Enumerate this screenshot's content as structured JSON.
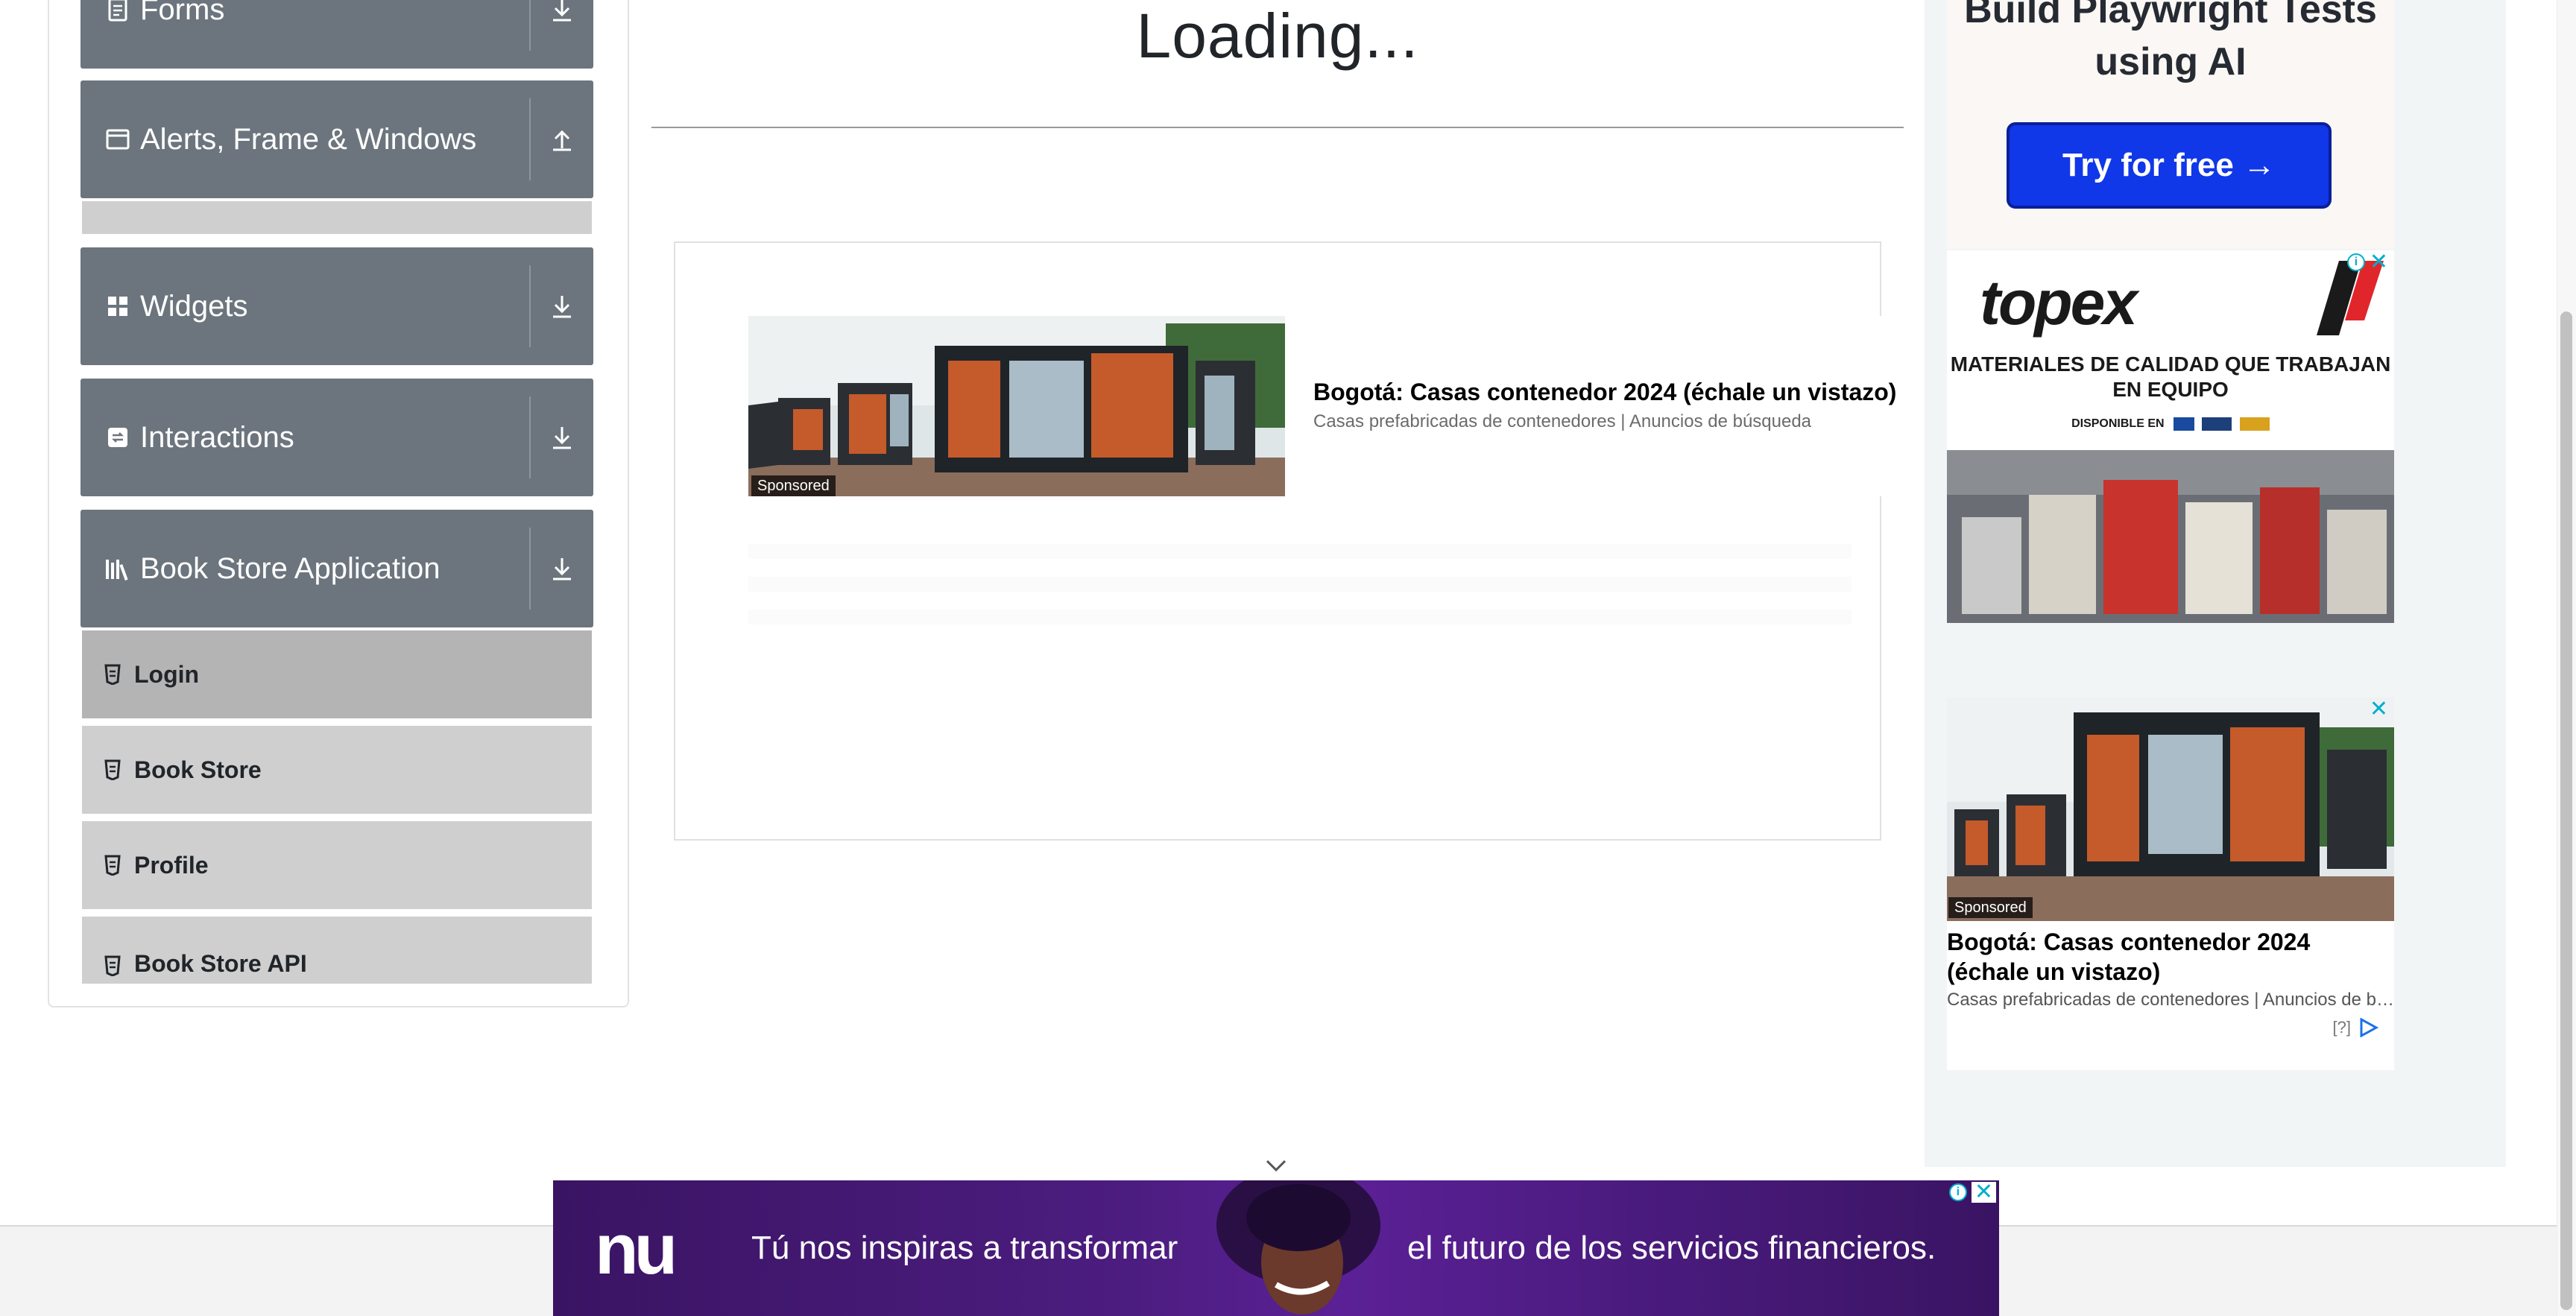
{
  "sidebar": {
    "groups": [
      {
        "title": "Forms",
        "icon": "document-icon",
        "toggle": "download-arrow-icon"
      },
      {
        "title": "Alerts, Frame & Windows",
        "icon": "window-icon",
        "toggle": "upload-arrow-icon"
      },
      {
        "title": "Widgets",
        "icon": "widgets-icon",
        "toggle": "download-arrow-icon"
      },
      {
        "title": "Interactions",
        "icon": "interactions-icon",
        "toggle": "download-arrow-icon"
      },
      {
        "title": "Book Store Application",
        "icon": "books-icon",
        "toggle": "download-arrow-icon"
      }
    ],
    "items": [
      {
        "label": "Login",
        "active": true
      },
      {
        "label": "Book Store",
        "active": false
      },
      {
        "label": "Profile",
        "active": false
      },
      {
        "label": "Book Store API",
        "active": false
      }
    ]
  },
  "main": {
    "title": "Loading...",
    "ad": {
      "sponsored": "Sponsored",
      "headline": "Bogotá: Casas contenedor 2024 (échale un vistazo)",
      "sub": "Casas prefabricadas de contenedores | Anuncios de búsqueda"
    }
  },
  "right_ads": {
    "playwright": {
      "title": "Build Playwright Tests using AI",
      "button": "Try for free →"
    },
    "topex": {
      "logo": "topex",
      "tagline": "MATERIALES DE CALIDAD QUE TRABAJAN EN EQUIPO",
      "available": "DISPONIBLE EN"
    },
    "house": {
      "sponsored": "Sponsored",
      "headline": "Bogotá: Casas contenedor 2024 (échale un vistazo)",
      "sub": "Casas prefabricadas de contenedores | Anuncios de búsqueda",
      "help": "[?]"
    }
  },
  "banner": {
    "logo": "nu",
    "text_left": "Tú nos inspiras a transformar",
    "text_right": "el futuro de los servicios financieros."
  },
  "colors": {
    "header_gray": "#6c757d",
    "item_gray": "#cfcfcf",
    "active_item": "#b4b4b4",
    "cta_blue": "#1037e8",
    "nu_purple": "#4c1d80"
  }
}
